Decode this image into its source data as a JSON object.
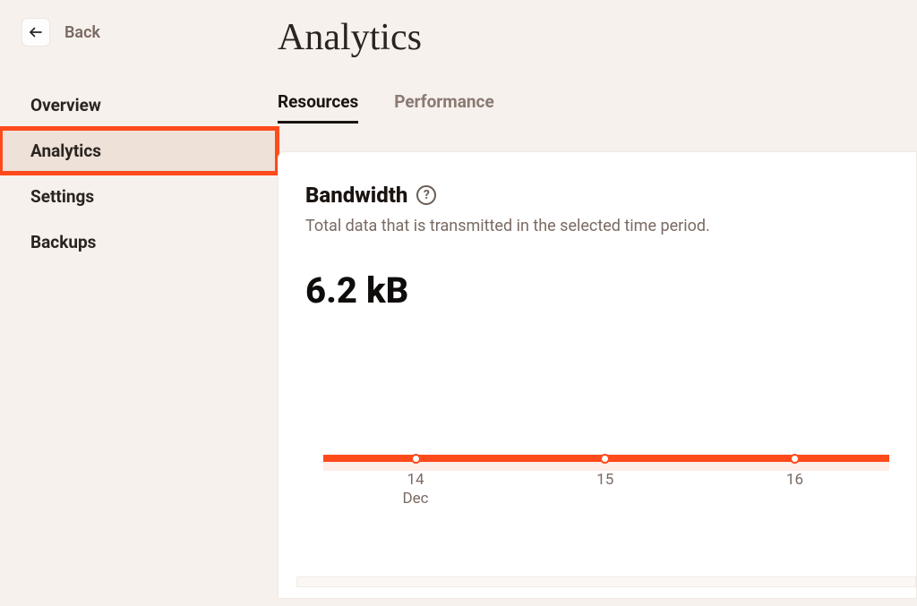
{
  "back": {
    "label": "Back"
  },
  "sidebar": {
    "items": [
      {
        "label": "Overview"
      },
      {
        "label": "Analytics"
      },
      {
        "label": "Settings"
      },
      {
        "label": "Backups"
      }
    ],
    "active_index": 1
  },
  "page": {
    "title": "Analytics"
  },
  "tabs": {
    "items": [
      {
        "label": "Resources"
      },
      {
        "label": "Performance"
      }
    ],
    "active_index": 0
  },
  "card": {
    "title": "Bandwidth",
    "description": "Total data that is transmitted in the selected time period.",
    "metric": "6.2 kB"
  },
  "chart_data": {
    "type": "line",
    "x_labels": [
      "14\nDec",
      "15",
      "16"
    ],
    "x_positions_pct": [
      16.3,
      49.8,
      83.3
    ],
    "series": [
      {
        "name": "Bandwidth",
        "values": [
          0,
          0,
          0
        ]
      }
    ],
    "title": "Bandwidth",
    "xlabel": "",
    "ylabel": "",
    "ylim": [
      0,
      0
    ],
    "accent_color": "#ff4a1c"
  }
}
